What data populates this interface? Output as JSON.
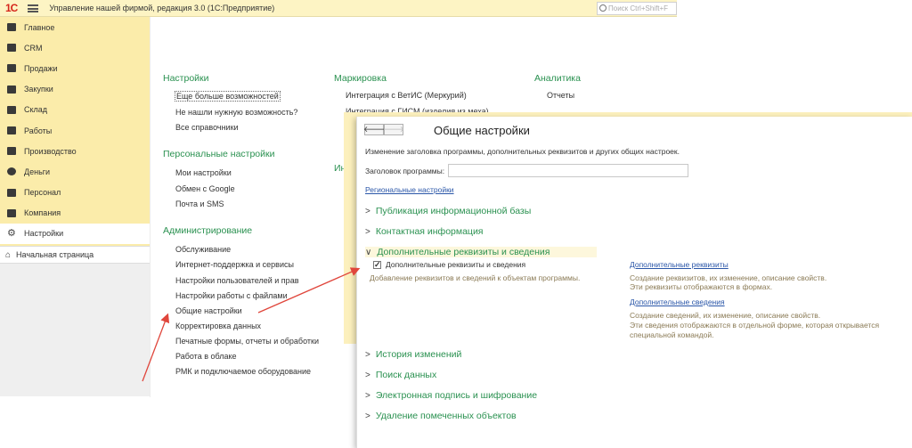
{
  "titlebar": {
    "logo": "1С",
    "title": "Управление нашей фирмой, редакция 3.0  (1С:Предприятие)",
    "search_placeholder": "Поиск Ctrl+Shift+F"
  },
  "sidebar": {
    "items": [
      {
        "label": "Главное",
        "icon": "menu-icon"
      },
      {
        "label": "CRM",
        "icon": "crm-icon"
      },
      {
        "label": "Продажи",
        "icon": "sales-icon"
      },
      {
        "label": "Закупки",
        "icon": "purchases-icon"
      },
      {
        "label": "Склад",
        "icon": "warehouse-icon"
      },
      {
        "label": "Работы",
        "icon": "works-icon"
      },
      {
        "label": "Производство",
        "icon": "production-icon"
      },
      {
        "label": "Деньги",
        "icon": "money-icon"
      },
      {
        "label": "Персонал",
        "icon": "staff-icon"
      },
      {
        "label": "Компания",
        "icon": "company-icon"
      },
      {
        "label": "Настройки",
        "icon": "gear-icon"
      }
    ],
    "home": "Начальная страница"
  },
  "main": {
    "settings": {
      "title": "Настройки",
      "links": [
        "Еще больше возможностей",
        "Не нашли нужную возможность?",
        "Все справочники"
      ]
    },
    "personal": {
      "title": "Персональные настройки",
      "links": [
        "Мои настройки",
        "Обмен с Google",
        "Почта и SMS"
      ]
    },
    "admin": {
      "title": "Администрирование",
      "links": [
        "Обслуживание",
        "Интернет-поддержка и сервисы",
        "Настройки пользователей и прав",
        "Настройки работы с файлами",
        "Общие настройки",
        "Корректировка данных",
        "Печатные формы, отчеты и обработки",
        "Работа в облаке",
        "РМК и подключаемое оборудование"
      ]
    },
    "marking": {
      "title": "Маркировка",
      "links": [
        "Интеграция с ВетИС (Меркурий)",
        "Интеграция с ГИСМ (изделия из меха)"
      ],
      "partial": "Ин"
    },
    "analytics": {
      "title": "Аналитика",
      "links": [
        "Отчеты"
      ]
    }
  },
  "popup": {
    "back": "🡐",
    "forward": "🡒",
    "title": "Общие настройки",
    "description": "Изменение заголовка программы, дополнительных реквизитов и других общих настроек.",
    "field_label": "Заголовок программы:",
    "field_value": "",
    "regional_link": "Региональные настройки",
    "sections": [
      "Публикация информационной базы",
      "Контактная информация",
      "Дополнительные реквизиты и сведения",
      "История изменений",
      "Поиск данных",
      "Электронная подпись и шифрование",
      "Удаление помеченных объектов"
    ],
    "checkbox_label": "Дополнительные реквизиты и сведения",
    "checkbox_checked": "✓",
    "checkbox_note": "Добавление реквизитов и сведений к объектам программы.",
    "attrs_link": "Дополнительные реквизиты",
    "attrs_note_1": "Создание реквизитов, их изменение, описание свойств.",
    "attrs_note_2": "Эти реквизиты отображаются в формах.",
    "info_link": "Дополнительные сведения",
    "info_note_1": "Создание сведений, их изменение, описание свойств.",
    "info_note_2": "Эти сведения отображаются в отдельной форме, которая открывается",
    "info_note_3": "специальной командой."
  },
  "colors": {
    "accent_green": "#2a9150",
    "link_blue": "#2a56a8",
    "sidebar_yellow": "#fbecaa",
    "arrow_red": "#e0463c"
  }
}
